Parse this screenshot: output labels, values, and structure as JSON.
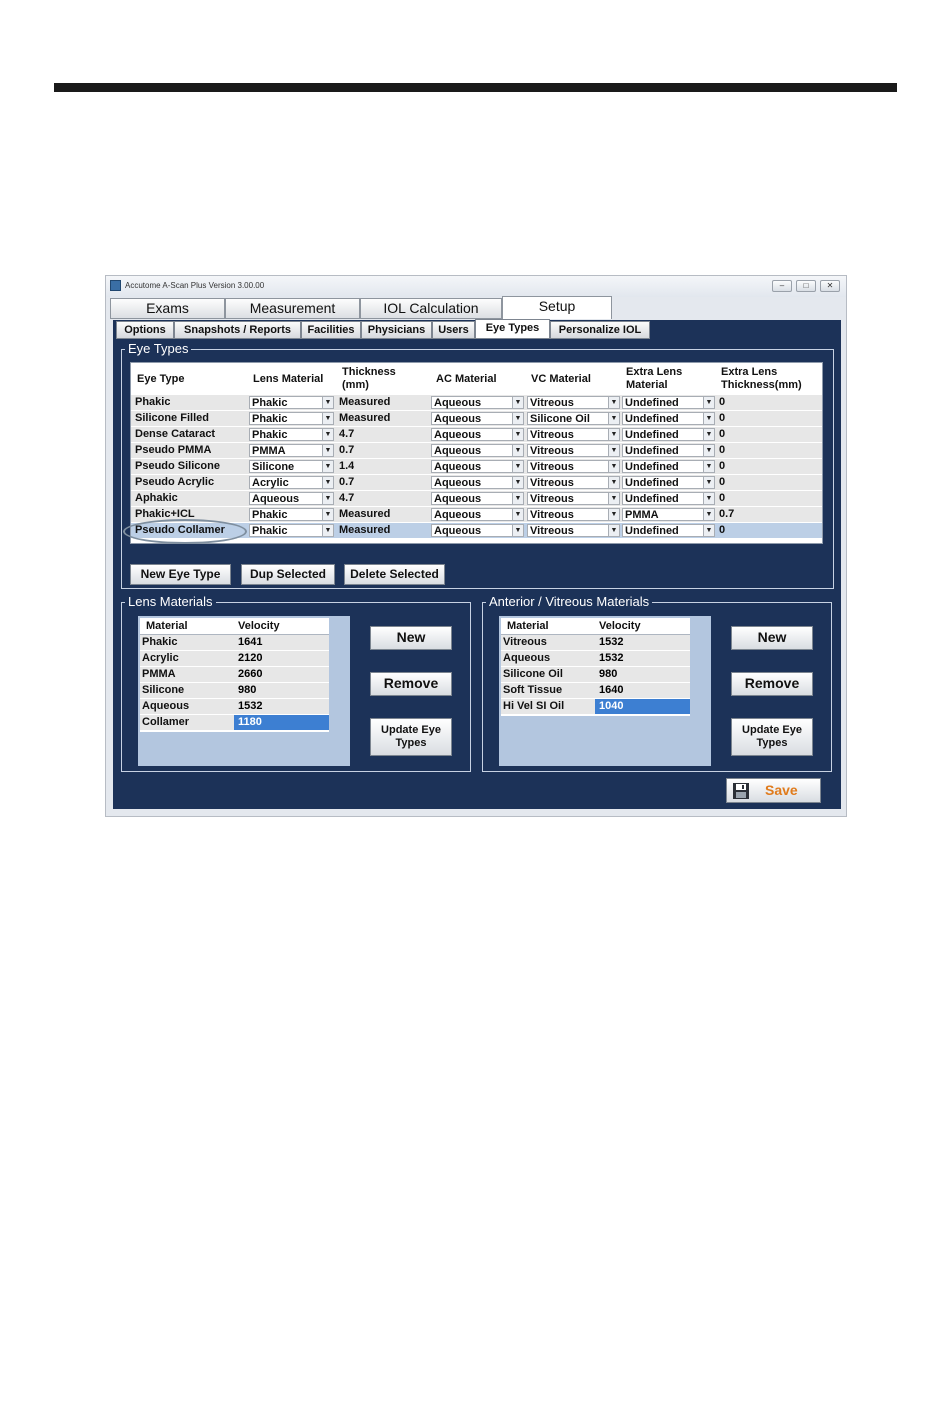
{
  "window": {
    "title": "Accutome A-Scan Plus Version 3.00.00"
  },
  "main_tabs": [
    "Exams",
    "Measurement",
    "IOL Calculation",
    "Setup"
  ],
  "sub_tabs": [
    "Options",
    "Snapshots / Reports",
    "Facilities",
    "Physicians",
    "Users",
    "Eye Types",
    "Personalize IOL"
  ],
  "eye_types": {
    "label": "Eye Types",
    "headers": {
      "eye_type": "Eye Type",
      "lens_material": "Lens Material",
      "thickness_1": "Thickness",
      "thickness_2": "(mm)",
      "ac_material": "AC Material",
      "vc_material": "VC Material",
      "extra_material_1": "Extra Lens",
      "extra_material_2": "Material",
      "extra_thickness_1": "Extra Lens",
      "extra_thickness_2": "Thickness(mm)"
    },
    "rows": [
      {
        "eye_type": "Phakic",
        "lens": "Phakic",
        "thickness": "Measured",
        "ac": "Aqueous",
        "vc": "Vitreous",
        "extra_mat": "Undefined",
        "extra_thk": "0"
      },
      {
        "eye_type": "Silicone Filled",
        "lens": "Phakic",
        "thickness": "Measured",
        "ac": "Aqueous",
        "vc": "Silicone Oil",
        "extra_mat": "Undefined",
        "extra_thk": "0"
      },
      {
        "eye_type": "Dense Cataract",
        "lens": "Phakic",
        "thickness": "4.7",
        "ac": "Aqueous",
        "vc": "Vitreous",
        "extra_mat": "Undefined",
        "extra_thk": "0"
      },
      {
        "eye_type": "Pseudo PMMA",
        "lens": "PMMA",
        "thickness": "0.7",
        "ac": "Aqueous",
        "vc": "Vitreous",
        "extra_mat": "Undefined",
        "extra_thk": "0"
      },
      {
        "eye_type": "Pseudo Silicone",
        "lens": "Silicone",
        "thickness": "1.4",
        "ac": "Aqueous",
        "vc": "Vitreous",
        "extra_mat": "Undefined",
        "extra_thk": "0"
      },
      {
        "eye_type": "Pseudo Acrylic",
        "lens": "Acrylic",
        "thickness": "0.7",
        "ac": "Aqueous",
        "vc": "Vitreous",
        "extra_mat": "Undefined",
        "extra_thk": "0"
      },
      {
        "eye_type": "Aphakic",
        "lens": "Aqueous",
        "thickness": "4.7",
        "ac": "Aqueous",
        "vc": "Vitreous",
        "extra_mat": "Undefined",
        "extra_thk": "0"
      },
      {
        "eye_type": "Phakic+ICL",
        "lens": "Phakic",
        "thickness": "Measured",
        "ac": "Aqueous",
        "vc": "Vitreous",
        "extra_mat": "PMMA",
        "extra_thk": "0.7"
      },
      {
        "eye_type": "Pseudo Collamer",
        "lens": "Phakic",
        "thickness": "Measured",
        "ac": "Aqueous",
        "vc": "Vitreous",
        "extra_mat": "Undefined",
        "extra_thk": "0"
      }
    ],
    "buttons": {
      "new": "New Eye Type",
      "dup": "Dup Selected",
      "delete": "Delete Selected"
    }
  },
  "lens_materials": {
    "label": "Lens Materials",
    "headers": {
      "material": "Material",
      "velocity": "Velocity"
    },
    "rows": [
      {
        "material": "Phakic",
        "velocity": "1641"
      },
      {
        "material": "Acrylic",
        "velocity": "2120"
      },
      {
        "material": "PMMA",
        "velocity": "2660"
      },
      {
        "material": "Silicone",
        "velocity": "980"
      },
      {
        "material": "Aqueous",
        "velocity": "1532"
      },
      {
        "material": "Collamer",
        "velocity": "1180"
      }
    ],
    "buttons": {
      "new": "New",
      "remove": "Remove",
      "update_1": "Update Eye",
      "update_2": "Types"
    }
  },
  "av_materials": {
    "label": "Anterior / Vitreous Materials",
    "headers": {
      "material": "Material",
      "velocity": "Velocity"
    },
    "rows": [
      {
        "material": "Vitreous",
        "velocity": "1532"
      },
      {
        "material": "Aqueous",
        "velocity": "1532"
      },
      {
        "material": "Silicone Oil",
        "velocity": "980"
      },
      {
        "material": "Soft Tissue",
        "velocity": "1640"
      },
      {
        "material": "Hi Vel SI Oil",
        "velocity": "1040"
      }
    ],
    "buttons": {
      "new": "New",
      "remove": "Remove",
      "update_1": "Update  Eye",
      "update_2": "Types"
    }
  },
  "save_label": "Save",
  "colors": {
    "panel": "#1c3258",
    "selected_row": "#bccfe6",
    "selected_cell": "#3d7fd2",
    "save_text": "#e07b1c"
  }
}
